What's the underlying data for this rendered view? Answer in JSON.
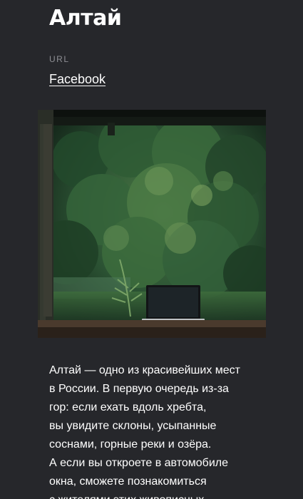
{
  "header": {
    "title": "Алтай"
  },
  "url_block": {
    "label": "URL",
    "link_text": "Facebook"
  },
  "image": {
    "subject": "forest-with-laptop-photo"
  },
  "description": {
    "lines": [
      "Алтай — одно из красивейших мест",
      "в России. В первую очередь из-за",
      "гор: если ехать вдоль хребта,",
      "вы увидите склоны, усыпанные",
      "соснами, горные реки и озёра.",
      "А если вы откроете в автомобиле",
      "окна, сможете познакомиться",
      "с жителями этих живописных"
    ]
  },
  "colors": {
    "background": "#26272b",
    "text": "#ffffff",
    "muted": "#8e8f94"
  }
}
